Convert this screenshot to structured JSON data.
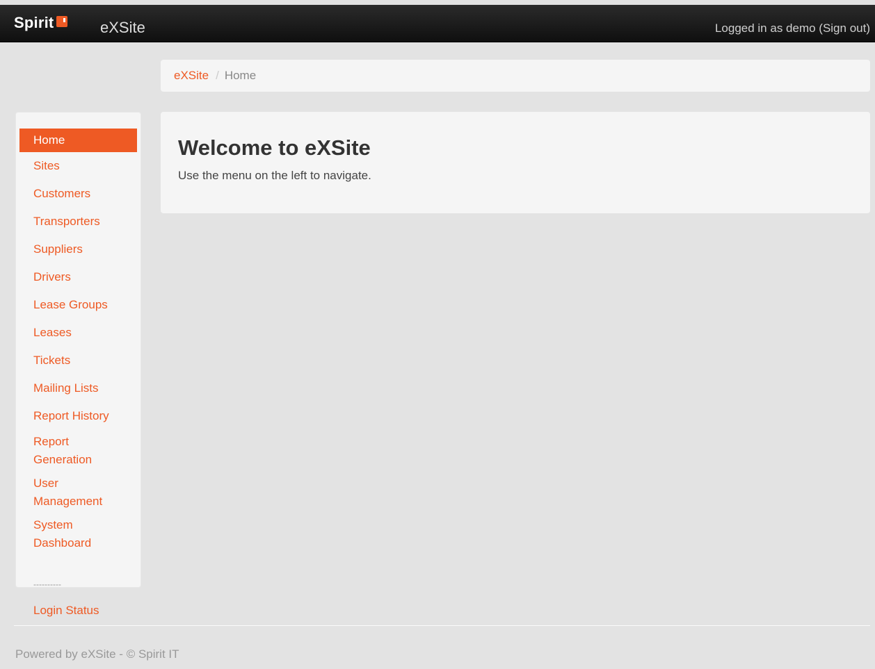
{
  "header": {
    "brand_word": "Spirit",
    "app_name": "eXSite",
    "login_text": "Logged in as demo (Sign out)"
  },
  "breadcrumb": {
    "root": "eXSite",
    "separator": "/",
    "current": "Home"
  },
  "sidebar": {
    "items": [
      {
        "label": "Home",
        "active": true
      },
      {
        "label": "Sites"
      },
      {
        "label": "Customers"
      },
      {
        "label": "Transporters"
      },
      {
        "label": "Suppliers"
      },
      {
        "label": "Drivers"
      },
      {
        "label": "Lease Groups"
      },
      {
        "label": "Leases"
      },
      {
        "label": "Tickets"
      },
      {
        "label": "Mailing Lists"
      },
      {
        "label": "Report History"
      },
      {
        "label": "Report Generation"
      },
      {
        "label": "User Management"
      },
      {
        "label": "System Dashboard"
      }
    ],
    "divider": "----------",
    "login_status": "Login Status"
  },
  "main": {
    "title": "Welcome to eXSite",
    "subtitle": "Use the menu on the left to navigate."
  },
  "footer": {
    "text": "Powered by eXSite - © Spirit IT"
  },
  "colors": {
    "accent": "#ee5a24",
    "topbar": "#1a1a1a",
    "background": "#e3e3e3",
    "panel": "#f5f5f5"
  }
}
